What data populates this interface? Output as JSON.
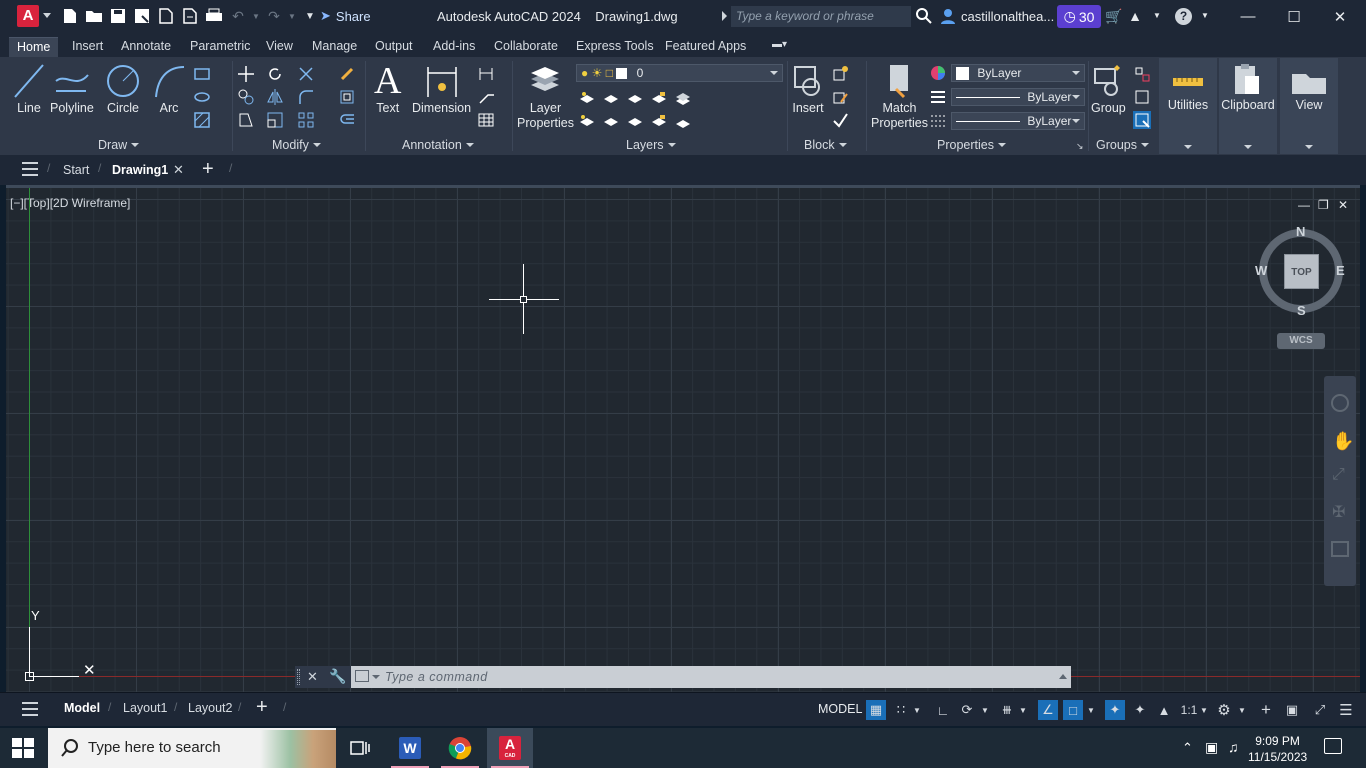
{
  "window": {
    "app_title": "Autodesk AutoCAD 2024",
    "file_title": "Drawing1.dwg",
    "share_label": "Share",
    "search_placeholder": "Type a keyword or phrase",
    "user_name": "castillonalthea...",
    "trial_days": "30",
    "app_letter": "A"
  },
  "ribbon_tabs": [
    "Home",
    "Insert",
    "Annotate",
    "Parametric",
    "View",
    "Manage",
    "Output",
    "Add-ins",
    "Collaborate",
    "Express Tools",
    "Featured Apps"
  ],
  "ribbon": {
    "draw": {
      "title": "Draw",
      "line": "Line",
      "polyline": "Polyline",
      "circle": "Circle",
      "arc": "Arc"
    },
    "modify": {
      "title": "Modify"
    },
    "annotation": {
      "title": "Annotation",
      "text": "Text",
      "dimension": "Dimension"
    },
    "layers": {
      "title": "Layers",
      "layer_properties_1": "Layer",
      "layer_properties_2": "Properties",
      "current_layer": "0"
    },
    "block": {
      "title": "Block",
      "insert": "Insert"
    },
    "properties": {
      "title": "Properties",
      "match_1": "Match",
      "match_2": "Properties",
      "color": "ByLayer",
      "linetype": "ByLayer",
      "lineweight": "ByLayer"
    },
    "groups": {
      "title": "Groups",
      "group": "Group"
    },
    "utilities": "Utilities",
    "clipboard": "Clipboard",
    "view": "View"
  },
  "file_tabs": {
    "start": "Start",
    "drawing": "Drawing1"
  },
  "viewport": {
    "label": "[−][Top][2D Wireframe]",
    "viewcube_face": "TOP",
    "compass": {
      "n": "N",
      "s": "S",
      "e": "E",
      "w": "W"
    },
    "wcs": "WCS",
    "ucs_y": "Y"
  },
  "command_line": {
    "placeholder": "Type  a  command"
  },
  "status_bar": {
    "layouts": [
      "Model",
      "Layout1",
      "Layout2"
    ],
    "model_label": "MODEL",
    "scale": "1:1"
  },
  "taskbar": {
    "search_placeholder": "Type here to search",
    "time": "9:09 PM",
    "date": "11/15/2023",
    "cad_label": "CAD"
  },
  "colors": {
    "accent": "#5b3fd0",
    "autocad_red": "#d8233d",
    "status_on": "#1a6fb8"
  }
}
